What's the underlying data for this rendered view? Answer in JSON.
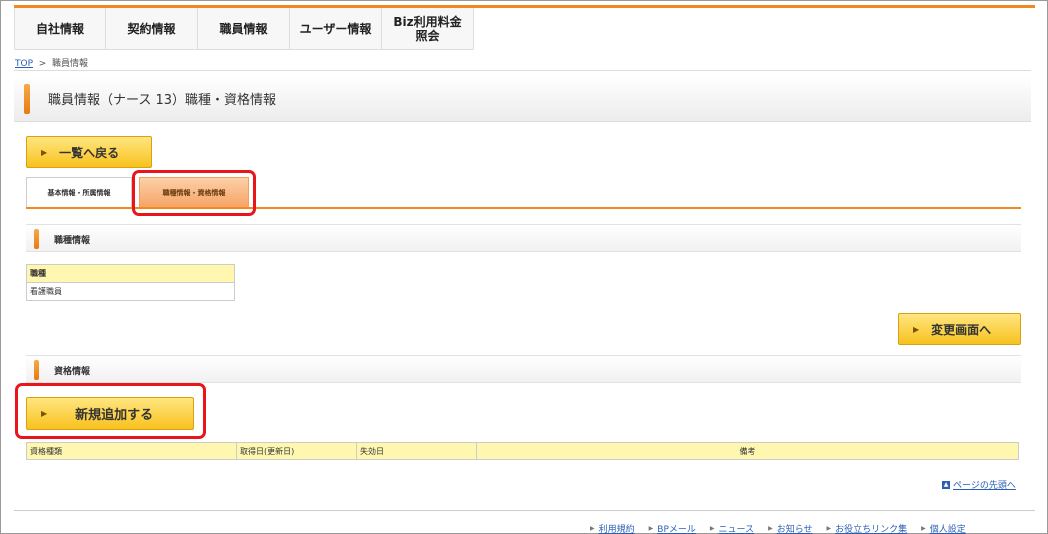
{
  "nav": {
    "items": [
      "自社情報",
      "契約情報",
      "職員情報",
      "ユーザー情報",
      "Biz利用料金\n照会"
    ]
  },
  "breadcrumb": {
    "top": "TOP",
    "sep": ">",
    "current": "職員情報"
  },
  "title": "職員情報（ナース 13）職種・資格情報",
  "buttons": {
    "back": "一覧へ戻る",
    "edit": "変更画面へ",
    "add": "新規追加する"
  },
  "tabs": {
    "basic": "基本情報・所属情報",
    "qual": "職種情報・資格情報"
  },
  "section1": {
    "title": "職種情報"
  },
  "table1": {
    "header": "職種",
    "value": "看護職員"
  },
  "section2": {
    "title": "資格情報"
  },
  "table2": {
    "headers": [
      "資格種類",
      "取得日(更新日)",
      "失効日",
      "備考"
    ]
  },
  "pagetop": "ページの先頭へ",
  "footer": [
    "利用規約",
    "BPメール",
    "ニュース",
    "お知らせ",
    "お役立ちリンク集",
    "個人設定"
  ],
  "colors": {
    "accent": "#f08a1c",
    "button": "#f8c21e",
    "highlight": "#e8161b",
    "header_bg": "#fff7b0"
  }
}
